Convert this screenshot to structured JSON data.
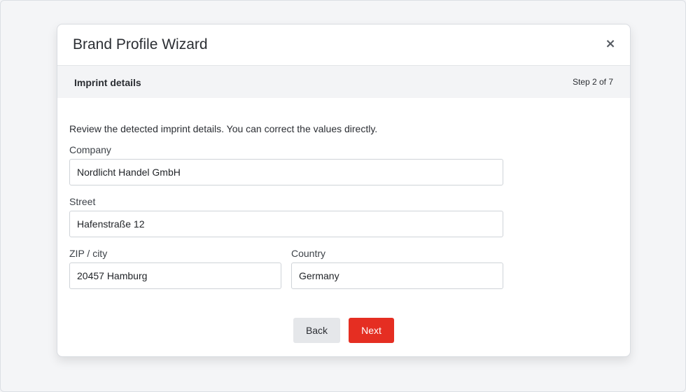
{
  "wizard": {
    "title": "Brand Profile Wizard",
    "close_label": "×"
  },
  "step": {
    "title": "Imprint details",
    "counter": "Step 2 of 7",
    "current": 2,
    "total": 7
  },
  "form": {
    "intro": "Review the detected imprint details. You can correct the values directly.",
    "company": {
      "label": "Company",
      "value": "Nordlicht Handel GmbH"
    },
    "street": {
      "label": "Street",
      "value": "Hafenstraße 12"
    },
    "zip_city": {
      "label": "ZIP / city",
      "value": "20457 Hamburg"
    },
    "country": {
      "label": "Country",
      "value": "Germany"
    }
  },
  "actions": {
    "back_label": "Back",
    "next_label": "Next"
  },
  "colors": {
    "primary": "#e52e22",
    "secondary": "#e5e7ea",
    "panel": "#f3f4f6"
  }
}
